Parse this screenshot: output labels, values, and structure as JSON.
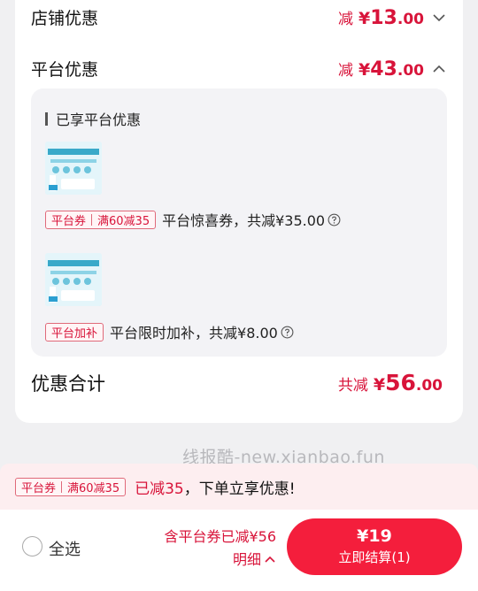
{
  "store_discount": {
    "label": "店铺优惠",
    "prefix": "减",
    "yen": "¥",
    "int": "13",
    "dec": ".00"
  },
  "platform_discount": {
    "label": "平台优惠",
    "prefix": "减",
    "yen": "¥",
    "int": "43",
    "dec": ".00"
  },
  "panel": {
    "title": "已享平台优惠",
    "items": [
      {
        "tag_parts": [
          "平台券",
          "满60减35"
        ],
        "text": "平台惊喜券，共减¥35.00"
      },
      {
        "tag_parts": [
          "平台加补"
        ],
        "text": "平台限时加补，共减¥8.00"
      }
    ]
  },
  "total": {
    "label": "优惠合计",
    "prefix": "共减",
    "yen": "¥",
    "int": "56",
    "dec": ".00"
  },
  "watermark": "线报酷-new.xianbao.fun",
  "coupon_strip": {
    "tag_a": "平台券",
    "tag_b": "满60减35",
    "msg_red": "已减35",
    "msg_rest": "，下单立享优惠!"
  },
  "bottom": {
    "select_all": "全选",
    "summary_line": "含平台券已减¥56",
    "detail": "明细",
    "price": "¥19",
    "checkout": "立即结算(1)"
  },
  "colors": {
    "accent": "#d8143a",
    "button": "#f41e3c",
    "strip": "#fdeef0"
  }
}
